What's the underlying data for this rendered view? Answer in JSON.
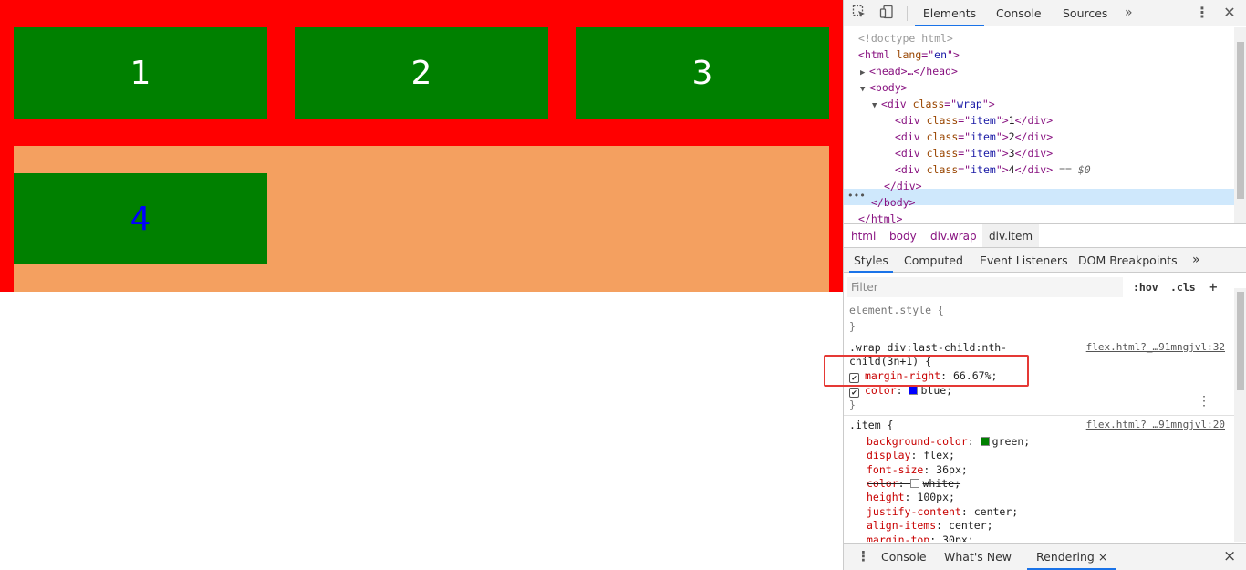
{
  "page": {
    "items": [
      {
        "label": "1"
      },
      {
        "label": "2"
      },
      {
        "label": "3"
      },
      {
        "label": "4"
      }
    ],
    "colors": {
      "wrap_bg": "#ff0000",
      "item_bg": "#008000",
      "last_row_bg": "#f4a060",
      "item4_text": "#0000ff"
    }
  },
  "devtools": {
    "tabs": [
      "Elements",
      "Console",
      "Sources"
    ],
    "active_tab": "Elements",
    "more_tabs_icon": "»",
    "icons": [
      "inspect-element-icon",
      "device-toolbar-icon",
      "kebab-menu-icon",
      "close-icon"
    ],
    "dom": {
      "doctype": "<!doctype html>",
      "html_open": {
        "tag": "html",
        "attr": "lang",
        "value": "en"
      },
      "head": "<head>…</head>",
      "body_open": "<body>",
      "wrap_open": {
        "attr": "class",
        "value": "wrap"
      },
      "items": [
        {
          "text": "1"
        },
        {
          "text": "2"
        },
        {
          "text": "3"
        },
        {
          "text": "4",
          "suffix": "== $0"
        }
      ],
      "div_close": "</div>",
      "body_close": "</body>",
      "html_close": "</html>",
      "item_class": "item"
    },
    "breadcrumbs": [
      "html",
      "body",
      "div.wrap",
      "div.item"
    ],
    "subtabs": [
      "Styles",
      "Computed",
      "Event Listeners",
      "DOM Breakpoints"
    ],
    "subtabs_more": "»",
    "filter": {
      "placeholder": "Filter",
      "hov": ":hov",
      "cls": ".cls",
      "add": "+"
    },
    "styles": {
      "element_style": "element.style {",
      "close_brace": "}",
      "rule1": {
        "selector_line1": ".wrap div:last-child:nth-",
        "selector_line2": "child(3n+1) {",
        "source": "flex.html?_…91mngjvl:32",
        "props": [
          {
            "name": "margin-right",
            "value": "66.67%;"
          },
          {
            "name": "color",
            "value": "blue;",
            "swatch": "#0000ff"
          }
        ]
      },
      "rule2": {
        "selector": ".item {",
        "source": "flex.html?_…91mngjvl:20",
        "props": [
          {
            "name": "background-color",
            "value": "green;",
            "swatch": "#008000"
          },
          {
            "name": "display",
            "value": "flex;"
          },
          {
            "name": "font-size",
            "value": "36px;"
          },
          {
            "name": "color",
            "value": "white;",
            "swatch": "#ffffff",
            "struck": true
          },
          {
            "name": "height",
            "value": "100px;"
          },
          {
            "name": "justify-content",
            "value": "center;"
          },
          {
            "name": "align-items",
            "value": "center;"
          },
          {
            "name": "margin-top",
            "value": "30px;"
          }
        ]
      }
    },
    "drawer": {
      "tabs": [
        "Console",
        "What's New",
        "Rendering"
      ],
      "active": "Rendering",
      "close_tab_icon": "×",
      "close_drawer_icon": "×"
    }
  }
}
